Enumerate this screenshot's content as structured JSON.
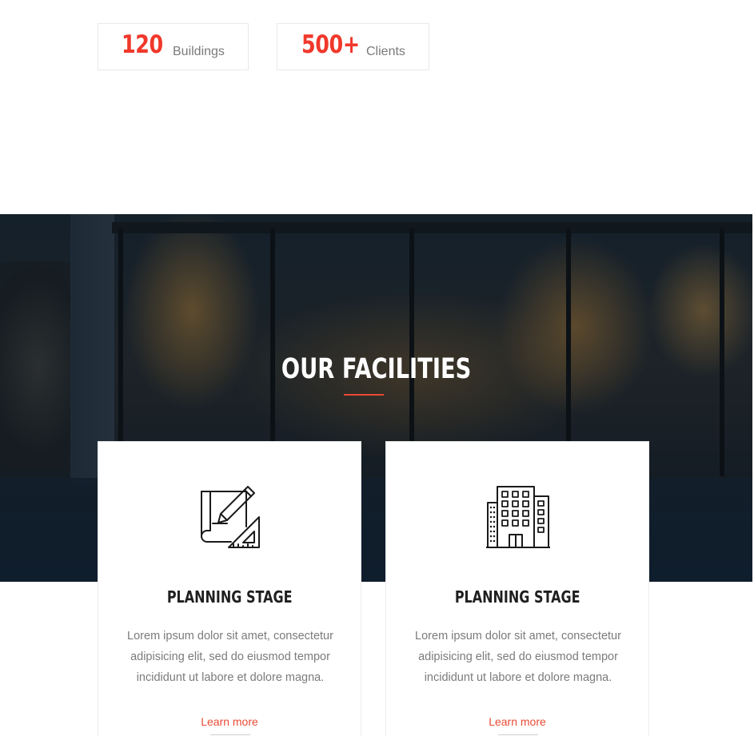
{
  "stats": [
    {
      "number": "120",
      "label": "Buildings"
    },
    {
      "number": "500+",
      "label": "Clients"
    }
  ],
  "facilities": {
    "title": "OUR FACILITIES",
    "cards": [
      {
        "icon": "blueprint-icon",
        "title": "PLANNING STAGE",
        "text": "Lorem ipsum dolor sit amet, consectetur adipisicing elit, sed do eiusmod tempor incididunt ut labore et dolore magna.",
        "link": "Learn more"
      },
      {
        "icon": "building-icon",
        "title": "PLANNING STAGE",
        "text": "Lorem ipsum dolor sit amet, consectetur adipisicing elit, sed do eiusmod tempor incididunt ut labore et dolore magna.",
        "link": "Learn more"
      }
    ]
  },
  "colors": {
    "accent": "#f0382b",
    "link": "#e94b35",
    "body_text": "#7b7b7b",
    "heading": "#1f1f1f"
  }
}
